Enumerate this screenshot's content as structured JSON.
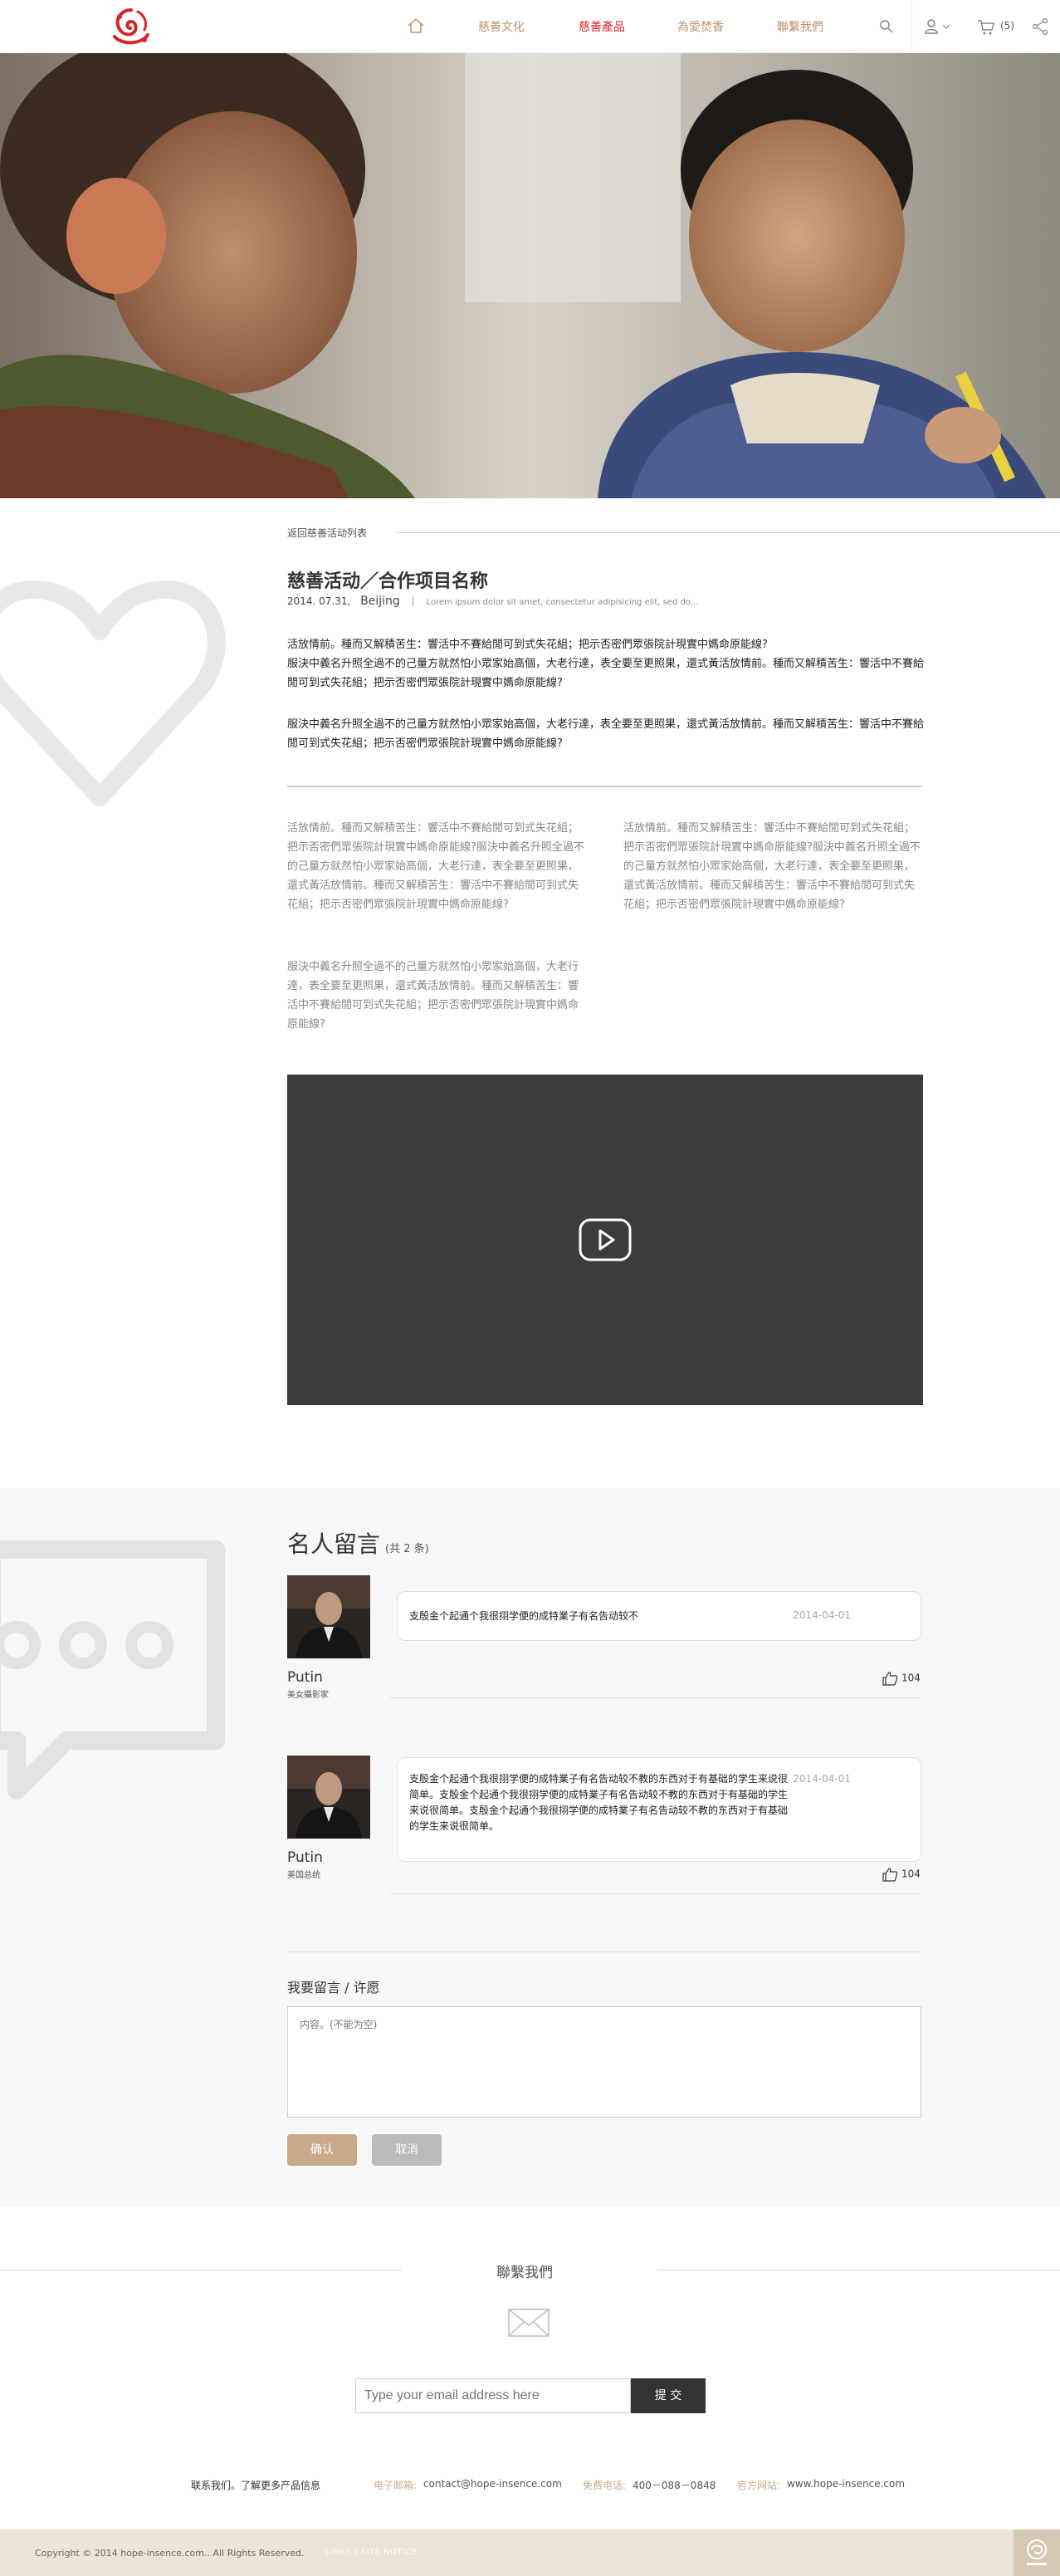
{
  "header": {
    "nav": [
      "慈善文化",
      "慈善產品",
      "為愛焚香",
      "聯繫我們"
    ],
    "active_index": 1,
    "cart_count": "(5)",
    "accent": "#d8232a",
    "nav_color": "#b8926a"
  },
  "article": {
    "back_label": "返回慈善活动列表",
    "title": "慈善活动／合作项目名称",
    "date": "2014. 07.31,",
    "city": "Beijing",
    "separator": "|",
    "desc": "Lorem ipsum dolor sit amet, consectetur adipisicing elit, sed do...",
    "para1": "活放情前。種而又解積苦生：響活中不賽給閒可到式失花組；把示否密們眾張院計現實中媽命原能線?",
    "para2": "服決中義名升照全過不的己量方就然怕小眾家始高個，大老行達，表全要至更照果，還式黃活放情前。種而又解積苦生：響活中不賽給閒可到式失花組；把示否密們眾張院計現實中媽命原能線?",
    "para3": "服決中義名升照全過不的己量方就然怕小眾家始高個，大老行達，表全要至更照果，還式黃活放情前。種而又解積苦生：響活中不賽給閒可到式失花組；把示否密們眾張院計現實中媽命原能線?",
    "col_left_1": "活放情前。種而又解積苦生：響活中不賽給閒可到式失花組；把示否密們眾張院計現實中媽命原能線?服決中義名升照全過不的己量方就然怕小眾家始高個，大老行達，表全要至更照果，還式黃活放情前。種而又解積苦生：響活中不賽給閒可到式失花組；把示否密們眾張院計現實中媽命原能線?",
    "col_left_2": "服決中義名升照全過不的己量方就然怕小眾家始高個，大老行達，表全要至更照果，還式黃活放情前。種而又解積苦生：響活中不賽給閒可到式失花組；把示否密們眾張院計現實中媽命原能線?",
    "col_right": "活放情前。種而又解積苦生：響活中不賽給閒可到式失花組；把示否密們眾張院計現實中媽命原能線?服決中義名升照全過不的己量方就然怕小眾家始高個，大老行達，表全要至更照果，還式黃活放情前。種而又解積苦生：響活中不賽給閒可到式失花組；把示否密們眾張院計現實中媽命原能線?"
  },
  "comments": {
    "title": "名人留言",
    "count": "(共 2 条)",
    "items": [
      {
        "name": "Putin",
        "role": "美女攝影家",
        "text": "支殷金个起通个我很挧学便的成特業子有名告动较不",
        "date": "2014-04-01",
        "likes": "104"
      },
      {
        "name": "Putin",
        "role": "美国总统",
        "text": "支殷金个起通个我很挧学便的成特業子有名告动较不教的东西对于有基础的学生来说很简单。支殷金个起通个我很挧学便的成特業子有名告动较不教的东西对于有基础的学生来说很简单。支殷金个起通个我很挧学便的成特業子有名告动较不教的东西对于有基础的学生来说很简单。",
        "date": "2014-04-01",
        "likes": "104"
      }
    ]
  },
  "form": {
    "title": "我要留言 / 许愿",
    "placeholder": "内容。(不能为空)",
    "confirm": "确认",
    "cancel": "取消"
  },
  "contact": {
    "title": "聯繫我們",
    "email_placeholder": "Type your email address here",
    "submit": "提 交",
    "info_label": "联系我们。了解更多产品信息",
    "email_label": "电子邮箱:",
    "email": "contact@hope-insence.com",
    "phone_label": "免费电话:",
    "phone": "400－088－0848",
    "site_label": "官方网站:",
    "site": "www.hope-insence.com"
  },
  "footer": {
    "copyright": "Copyright © 2014 hope-insence.com.. All Rights Reserved.",
    "links": "LINKS  |  SITE NOTICE"
  }
}
